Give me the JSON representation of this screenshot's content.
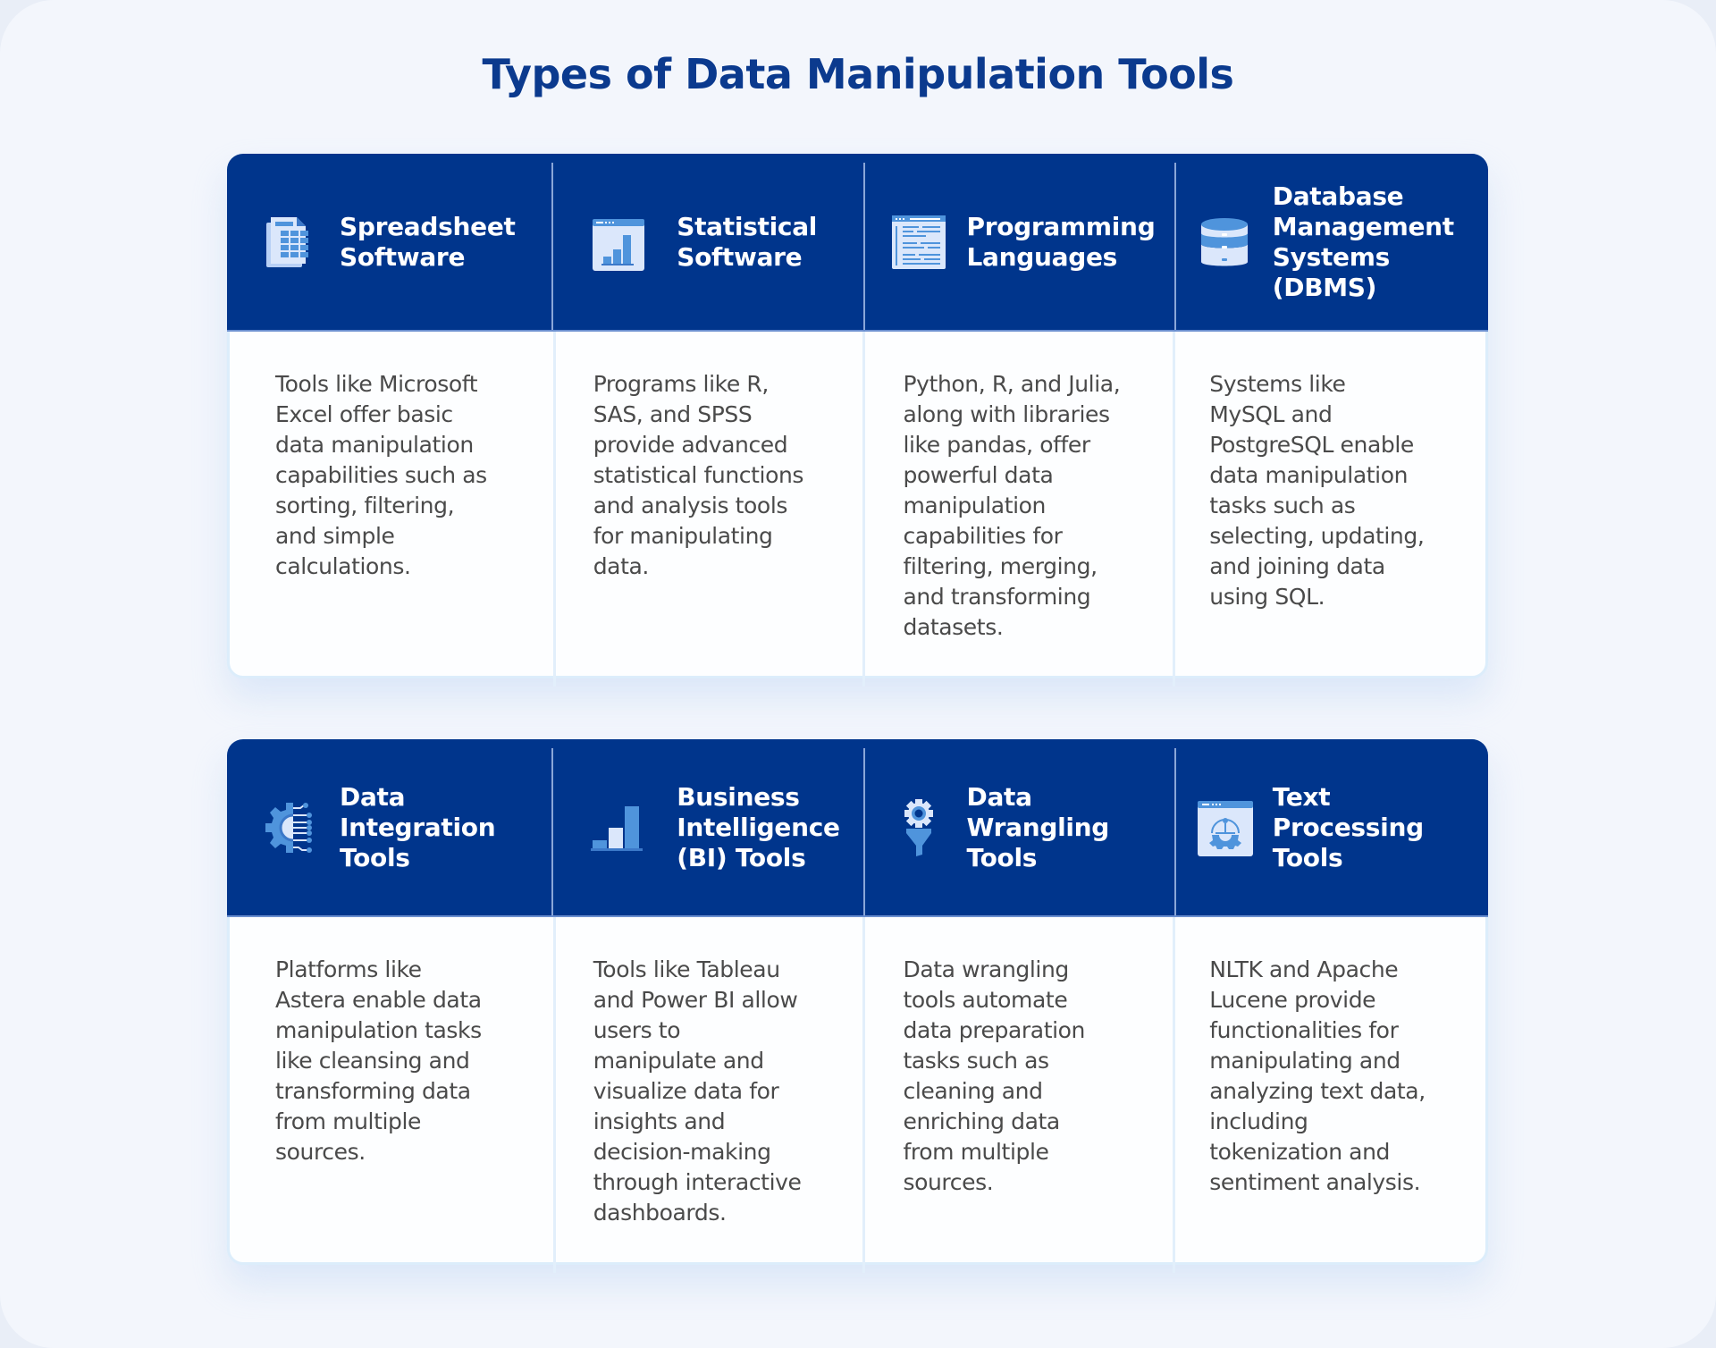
{
  "title": "Types of Data Manipulation Tools",
  "colors": {
    "header_bg": "#00358c",
    "title": "#0b3a8e",
    "icon_light": "#dbe7fb",
    "icon_mid": "#4f94dc",
    "body_text": "#4a4a4a",
    "page_bg": "#f3f6fc"
  },
  "rows": [
    {
      "tools": [
        {
          "icon": "spreadsheet-icon",
          "heading": "Spreadsheet\nSoftware",
          "description": "Tools like Microsoft\nExcel offer basic\ndata manipulation\ncapabilities such as\nsorting, filtering,\nand simple\ncalculations."
        },
        {
          "icon": "statistical-chart-window-icon",
          "heading": "Statistical\nSoftware",
          "description": "Programs like R,\nSAS, and SPSS\nprovide advanced\nstatistical functions\nand analysis tools\nfor manipulating\ndata."
        },
        {
          "icon": "code-window-icon",
          "heading": "Programming\nLanguages",
          "description": "Python, R, and Julia,\nalong with libraries\nlike pandas, offer\npowerful data\nmanipulation\ncapabilities for\nfiltering, merging,\nand transforming\ndatasets."
        },
        {
          "icon": "database-icon",
          "heading": "Database\nManagement\nSystems (DBMS)",
          "description": "Systems like\nMySQL and\nPostgreSQL enable\ndata manipulation\ntasks such as\nselecting, updating,\nand joining data\nusing SQL."
        }
      ]
    },
    {
      "tools": [
        {
          "icon": "gear-circuit-icon",
          "heading": "Data\nIntegration\nTools",
          "description": "Platforms like\nAstera enable data\nmanipulation tasks\nlike cleansing and\ntransforming data\nfrom multiple\nsources."
        },
        {
          "icon": "bar-chart-icon",
          "heading": "Business\nIntelligence\n(BI) Tools",
          "description": "Tools like Tableau\nand Power BI allow\nusers to\nmanipulate and\nvisualize data for\ninsights and\ndecision-making\nthrough interactive\ndashboards."
        },
        {
          "icon": "gear-funnel-icon",
          "heading": "Data\nWrangling\nTools",
          "description": "Data wrangling\ntools automate\ndata preparation\ntasks such as\ncleaning and\nenriching data\nfrom multiple\nsources."
        },
        {
          "icon": "text-processing-window-icon",
          "heading": "Text\nProcessing\nTools",
          "description": "NLTK and Apache\nLucene provide\nfunctionalities for\nmanipulating and\nanalyzing text data,\nincluding\ntokenization and\nsentiment analysis."
        }
      ]
    }
  ]
}
